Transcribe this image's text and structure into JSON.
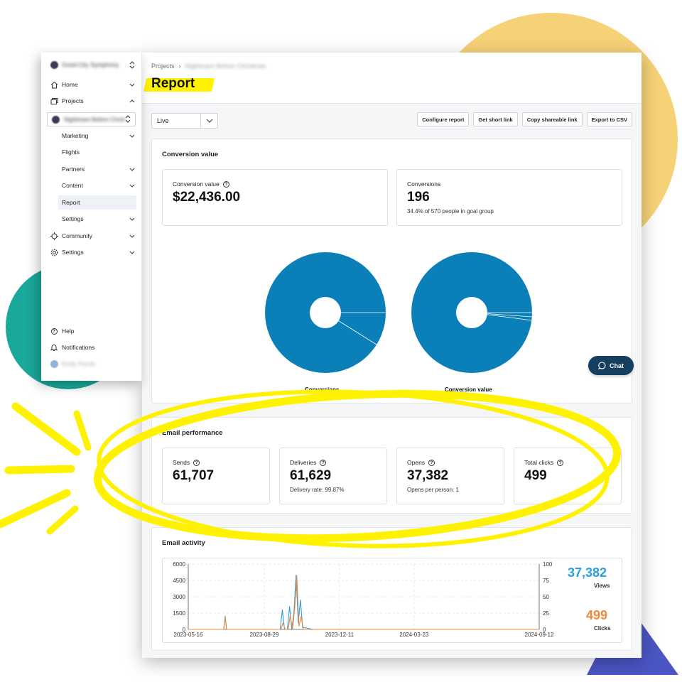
{
  "sidebar": {
    "org_name": "Good City Symphony",
    "items": [
      {
        "label": "Home",
        "icon": "home-icon"
      },
      {
        "label": "Projects",
        "icon": "folders-icon"
      }
    ],
    "project_name": "Nightmare Before Christmas",
    "project_items": [
      {
        "label": "Marketing",
        "has_chevron": true
      },
      {
        "label": "Flights",
        "has_chevron": false
      },
      {
        "label": "Partners",
        "has_chevron": true
      },
      {
        "label": "Content",
        "has_chevron": true
      },
      {
        "label": "Report",
        "has_chevron": false,
        "active": true
      },
      {
        "label": "Settings",
        "has_chevron": true
      }
    ],
    "bottom_items": [
      {
        "label": "Community",
        "icon": "crosshair-icon"
      },
      {
        "label": "Settings",
        "icon": "gear-icon"
      }
    ],
    "footer": [
      {
        "label": "Help",
        "icon": "help-icon"
      },
      {
        "label": "Notifications",
        "icon": "bell-icon"
      }
    ],
    "user_name": "Emily Purvis"
  },
  "header": {
    "breadcrumb_root": "Projects",
    "breadcrumb_sep": "›",
    "breadcrumb_project": "Nightmare Before Christmas",
    "title": "Report"
  },
  "controls": {
    "select_value": "Live",
    "buttons": [
      "Configure report",
      "Get short link",
      "Copy shareable link",
      "Export to CSV"
    ]
  },
  "conversion": {
    "title": "Conversion value",
    "value_label": "Conversion value",
    "value": "$22,436.00",
    "count_label": "Conversions",
    "count": "196",
    "count_sub": "34.4% of 570 people in goal group",
    "pie_labels": [
      "Conversions",
      "Conversion value"
    ]
  },
  "email_performance": {
    "title": "Email performance",
    "stats": [
      {
        "label": "Sends",
        "value": "61,707",
        "sub": ""
      },
      {
        "label": "Deliveries",
        "value": "61,629",
        "sub": "Delivery rate: 99.87%"
      },
      {
        "label": "Opens",
        "value": "37,382",
        "sub": "Opens per person: 1"
      },
      {
        "label": "Total clicks",
        "value": "499",
        "sub": ""
      }
    ]
  },
  "email_activity": {
    "title": "Email activity",
    "views_value": "37,382",
    "views_label": "Views",
    "clicks_value": "499",
    "clicks_label": "Clicks"
  },
  "chat": {
    "label": "Chat"
  },
  "colors": {
    "accent_blue": "#0a7fb8",
    "views_blue": "#2a9fdc",
    "clicks_orange": "#ef8a3d",
    "highlight_yellow": "#fff200"
  },
  "chart_data": {
    "type": "line",
    "x_ticks": [
      "2023-05-16",
      "2023-08-29",
      "2023-12-11",
      "2024-03-23",
      "2024-09-12"
    ],
    "y_left_ticks": [
      0,
      1500,
      3000,
      4500,
      6000
    ],
    "y_right_ticks": [
      0,
      25,
      50,
      75,
      100
    ],
    "ylim_left": [
      0,
      6000
    ],
    "ylim_right": [
      0,
      100
    ],
    "grid": true,
    "series": [
      {
        "name": "Views",
        "axis": "left",
        "color": "#2a9fdc",
        "points": [
          [
            "2023-05-16",
            0
          ],
          [
            "2023-07-04",
            0
          ],
          [
            "2023-07-06",
            1200
          ],
          [
            "2023-07-08",
            0
          ],
          [
            "2023-09-20",
            0
          ],
          [
            "2023-09-23",
            1800
          ],
          [
            "2023-09-26",
            0
          ],
          [
            "2023-09-30",
            0
          ],
          [
            "2023-10-03",
            2100
          ],
          [
            "2023-10-06",
            0
          ],
          [
            "2023-10-09",
            1500
          ],
          [
            "2023-10-12",
            5000
          ],
          [
            "2023-10-15",
            600
          ],
          [
            "2023-10-18",
            2700
          ],
          [
            "2023-10-21",
            200
          ],
          [
            "2023-11-05",
            0
          ],
          [
            "2024-09-12",
            0
          ]
        ]
      },
      {
        "name": "Clicks",
        "axis": "right",
        "color": "#ef8a3d",
        "points": [
          [
            "2023-05-16",
            0
          ],
          [
            "2023-07-04",
            0
          ],
          [
            "2023-07-06",
            18
          ],
          [
            "2023-07-08",
            0
          ],
          [
            "2023-09-21",
            0
          ],
          [
            "2023-09-24",
            10
          ],
          [
            "2023-09-27",
            0
          ],
          [
            "2023-10-01",
            0
          ],
          [
            "2023-10-04",
            22
          ],
          [
            "2023-10-07",
            0
          ],
          [
            "2023-10-10",
            30
          ],
          [
            "2023-10-13",
            82
          ],
          [
            "2023-10-16",
            5
          ],
          [
            "2023-10-19",
            20
          ],
          [
            "2023-10-22",
            0
          ],
          [
            "2024-09-12",
            0
          ]
        ]
      }
    ]
  }
}
